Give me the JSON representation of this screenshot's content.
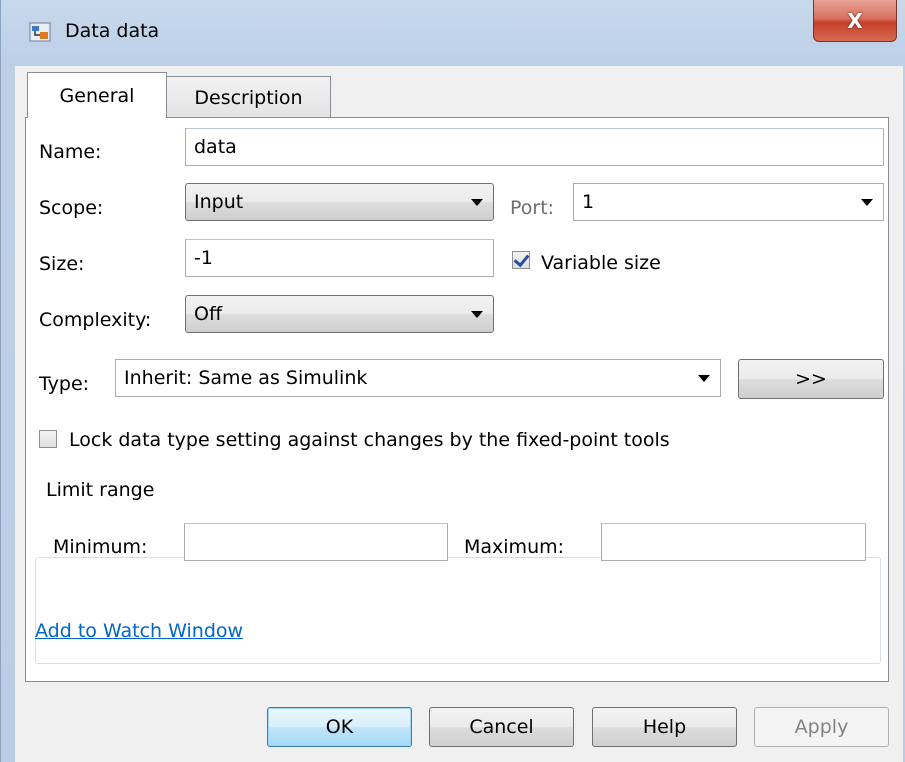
{
  "window": {
    "title": "Data data",
    "close_label": "X",
    "accent": "#c7402a"
  },
  "tabs": [
    {
      "label": "General",
      "active": true
    },
    {
      "label": "Description",
      "active": false
    }
  ],
  "form": {
    "name_label": "Name:",
    "name_value": "data",
    "scope_label": "Scope:",
    "scope_value": "Input",
    "port_label": "Port:",
    "port_value": "1",
    "size_label": "Size:",
    "size_value": "-1",
    "variable_size_label": "Variable size",
    "variable_size_checked": true,
    "complexity_label": "Complexity:",
    "complexity_value": "Off",
    "type_label": "Type:",
    "type_value": "Inherit: Same as Simulink",
    "type_assistant_label": ">>",
    "lock_label": "Lock data type setting against changes by the fixed-point tools",
    "lock_checked": false
  },
  "limit_range": {
    "title": "Limit range",
    "minimum_label": "Minimum:",
    "minimum_value": "",
    "maximum_label": "Maximum:",
    "maximum_value": ""
  },
  "watch_link": "Add to Watch Window",
  "buttons": {
    "ok": "OK",
    "cancel": "Cancel",
    "help": "Help",
    "apply": "Apply"
  }
}
